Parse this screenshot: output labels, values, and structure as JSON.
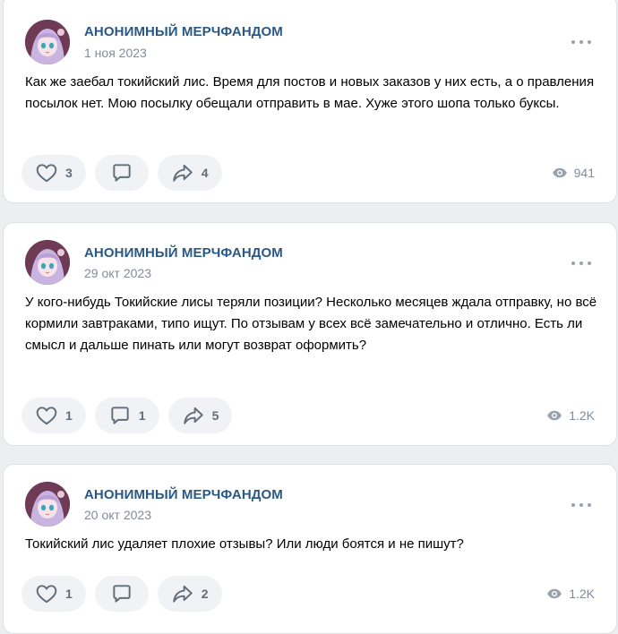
{
  "posts": [
    {
      "author": "АНОНИМНЫЙ МЕРЧФАНДОМ",
      "date": "1 ноя 2023",
      "text": "Как же заебал токийский лис. Время для постов и новых заказов у них есть, а о правления посылок нет. Мою посылку обещали отправить в мае. Хуже этого шопа только буксы.",
      "likes": "3",
      "comments": "",
      "shares": "4",
      "views": "941"
    },
    {
      "author": "АНОНИМНЫЙ МЕРЧФАНДОМ",
      "date": "29 окт 2023",
      "text": "У кого-нибудь Токийские лисы теряли позиции? Несколько месяцев ждала отправку, но всё кормили завтраками, типо ищут. По отзывам у всех всё замечательно и отлично. Есть ли смысл и дальше пинать или могут возврат оформить?",
      "likes": "1",
      "comments": "1",
      "shares": "5",
      "views": "1.2K"
    },
    {
      "author": "АНОНИМНЫЙ МЕРЧФАНДОМ",
      "date": "20 окт 2023",
      "text": "Токийский лис удаляет плохие отзывы? Или люди боятся и не пишут?",
      "likes": "1",
      "comments": "",
      "shares": "2",
      "views": "1.2K"
    }
  ],
  "icons": {
    "like": "heart-icon",
    "comment": "comment-icon",
    "share": "share-icon",
    "views": "eye-icon",
    "more": "more-icon"
  },
  "colors": {
    "author": "#2a5885",
    "secondary": "#818c99",
    "action_bg": "#f0f2f5",
    "action_icon": "#626d7a",
    "page_bg": "#edeef0"
  }
}
